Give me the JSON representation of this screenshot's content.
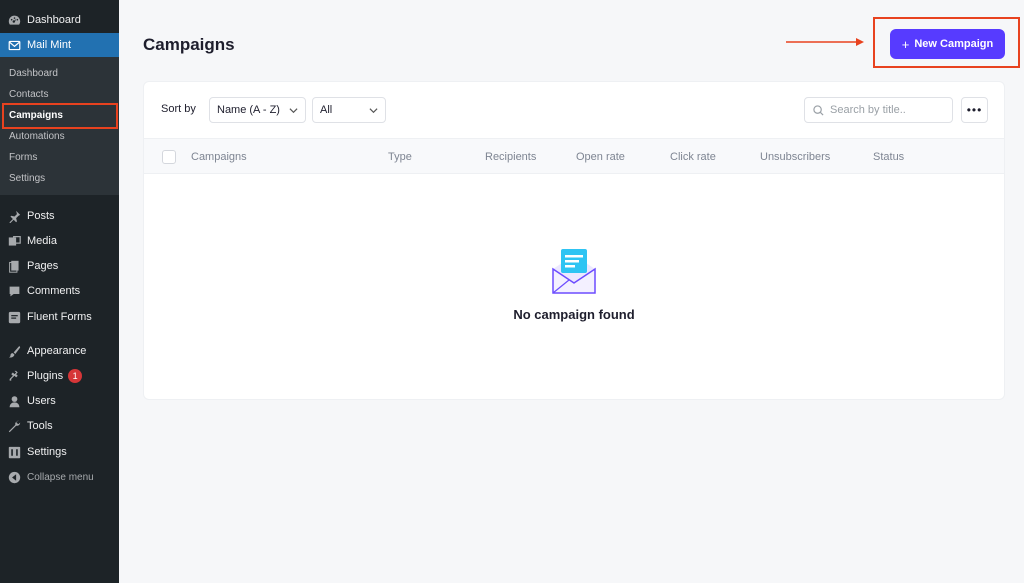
{
  "sidebar": {
    "top_item": {
      "label": "Dashboard",
      "icon": "dashboard-icon"
    },
    "active_item": {
      "label": "Mail Mint",
      "icon": "mail-icon"
    },
    "submenu": [
      {
        "label": "Dashboard"
      },
      {
        "label": "Contacts"
      },
      {
        "label": "Campaigns"
      },
      {
        "label": "Automations"
      },
      {
        "label": "Forms"
      },
      {
        "label": "Settings"
      }
    ],
    "items": [
      {
        "label": "Posts",
        "icon": "pin-icon"
      },
      {
        "label": "Media",
        "icon": "media-icon"
      },
      {
        "label": "Pages",
        "icon": "pages-icon"
      },
      {
        "label": "Comments",
        "icon": "comment-icon"
      },
      {
        "label": "Fluent Forms",
        "icon": "forms-icon"
      },
      {
        "label": "Appearance",
        "icon": "brush-icon"
      },
      {
        "label": "Plugins",
        "icon": "plugin-icon",
        "badge": "1"
      },
      {
        "label": "Users",
        "icon": "user-icon"
      },
      {
        "label": "Tools",
        "icon": "wrench-icon"
      },
      {
        "label": "Settings",
        "icon": "settings-icon"
      }
    ],
    "collapse_label": "Collapse menu"
  },
  "header": {
    "title": "Campaigns",
    "new_button": "New Campaign"
  },
  "toolbar": {
    "sort_label": "Sort by",
    "sort_value": "Name (A - Z)",
    "filter_value": "All",
    "search_placeholder": "Search by title.."
  },
  "table": {
    "columns": [
      "Campaigns",
      "Type",
      "Recipients",
      "Open rate",
      "Click rate",
      "Unsubscribers",
      "Status"
    ]
  },
  "empty_state": {
    "message": "No campaign found"
  },
  "colors": {
    "accent": "#573bff",
    "sidebar_bg": "#1d2327",
    "active_menu": "#2271b1",
    "highlight": "#e8421f"
  }
}
